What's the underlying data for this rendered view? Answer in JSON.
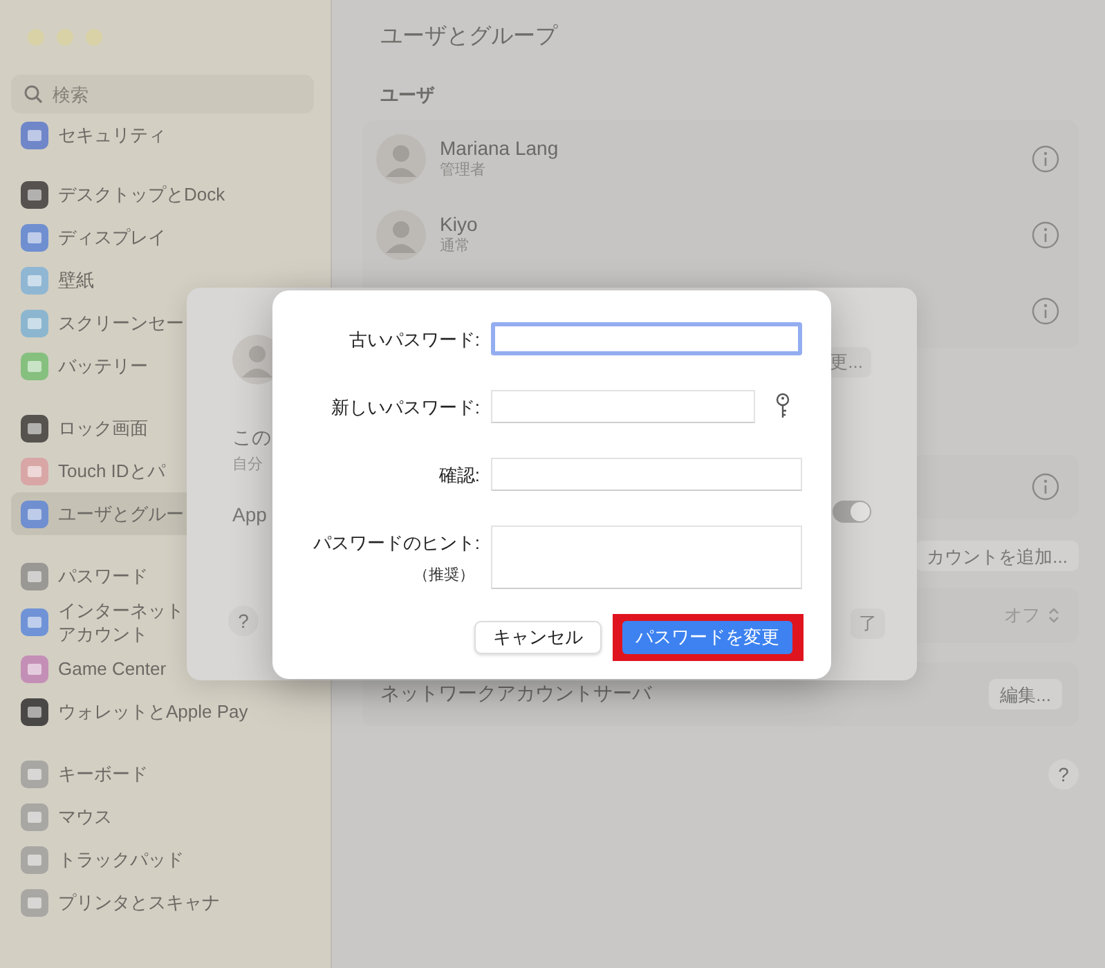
{
  "sidebar": {
    "search": {
      "placeholder": "検索"
    },
    "groups": [
      {
        "items": [
          {
            "label": "セキュリティ",
            "color": "#6f86c9",
            "selected": false
          }
        ]
      },
      {
        "items": [
          {
            "label": "デスクトップとDock",
            "color": "#55524f",
            "selected": false
          },
          {
            "label": "ディスプレイ",
            "color": "#6f8fd0",
            "selected": false
          },
          {
            "label": "壁紙",
            "color": "#8fb7d3",
            "selected": false
          },
          {
            "label": "スクリーンセー",
            "color": "#8cb6cf",
            "selected": false
          },
          {
            "label": "バッテリー",
            "color": "#86c07f",
            "selected": false
          }
        ]
      },
      {
        "items": [
          {
            "label": "ロック画面",
            "color": "#56534f",
            "selected": false
          },
          {
            "label": "Touch IDとパ",
            "color": "#d9a6a6",
            "selected": false
          },
          {
            "label": "ユーザとグルー",
            "color": "#6f8fd0",
            "selected": true
          }
        ]
      },
      {
        "items": [
          {
            "label": "パスワード",
            "color": "#9a9894",
            "selected": false
          },
          {
            "label": "インターネット",
            "label_2": "アカウント",
            "color": "#6f93d6",
            "selected": false
          },
          {
            "label": "Game Center",
            "color": "#c48fb6",
            "selected": false
          },
          {
            "label": "ウォレットとApple Pay",
            "color": "#4a4846",
            "selected": false
          }
        ]
      },
      {
        "items": [
          {
            "label": "キーボード",
            "color": "#a9a7a3",
            "selected": false
          },
          {
            "label": "マウス",
            "color": "#a9a7a3",
            "selected": false
          },
          {
            "label": "トラックパッド",
            "color": "#a9a7a3",
            "selected": false
          },
          {
            "label": "プリンタとスキャナ",
            "color": "#a9a7a3",
            "selected": false
          }
        ]
      }
    ]
  },
  "main": {
    "title": "ユーザとグループ",
    "section": "ユーザ",
    "users": [
      {
        "name": "Mariana Lang",
        "role": "管理者"
      },
      {
        "name": "Kiyo",
        "role": "通常"
      }
    ],
    "add_account_button": "カウントを追加...",
    "auto_login_value": "オフ",
    "network_server_label": "ネットワークアカウントサーバ",
    "edit_button": "編集...",
    "help": "?"
  },
  "sheet": {
    "top_button": "更...",
    "line_1": "この",
    "line_2": "自分",
    "app_label": "App",
    "toggle": {
      "on": true
    },
    "help": "?",
    "done_button": "了"
  },
  "dialog": {
    "fields": [
      {
        "label": "古いパスワード:",
        "kind": "password",
        "focused": true
      },
      {
        "label": "新しいパスワード:",
        "kind": "new_password",
        "focused": false
      },
      {
        "label": "確認:",
        "kind": "password",
        "focused": false
      },
      {
        "label": "パスワードのヒント:",
        "sublabel": "（推奨）",
        "kind": "multiline",
        "focused": false
      }
    ],
    "cancel_button": "キャンセル",
    "confirm_button": "パスワードを変更",
    "confirm_highlighted": true
  }
}
